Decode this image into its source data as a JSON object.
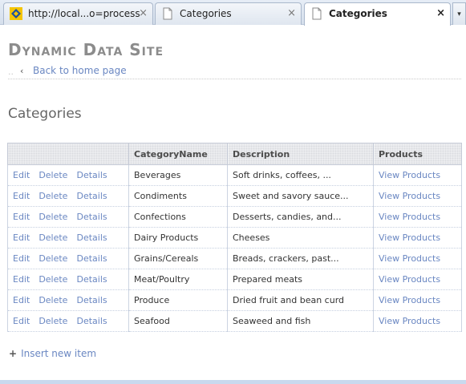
{
  "browser": {
    "tabs": [
      {
        "label": "http://local...o=processar",
        "close": "×",
        "icon": "site-favicon-icon",
        "active": false
      },
      {
        "label": "Categories",
        "close": "×",
        "icon": "page-icon",
        "active": false
      },
      {
        "label": "Categories",
        "close": "×",
        "icon": "page-icon",
        "active": true
      }
    ],
    "dropdown": "▾"
  },
  "page": {
    "site_title": "Dynamic Data Site",
    "home_link": "Back to home page",
    "heading": "Categories",
    "insert_link": "Insert new item"
  },
  "grid": {
    "columns": [
      "",
      "CategoryName",
      "Description",
      "Products"
    ],
    "action_labels": {
      "edit": "Edit",
      "delete": "Delete",
      "details": "Details"
    },
    "rows": [
      {
        "name": "Beverages",
        "description": "Soft drinks, coffees, ...",
        "products": "View Products"
      },
      {
        "name": "Condiments",
        "description": "Sweet and savory sauce...",
        "products": "View Products"
      },
      {
        "name": "Confections",
        "description": "Desserts, candies, and...",
        "products": "View Products"
      },
      {
        "name": "Dairy Products",
        "description": "Cheeses",
        "products": "View Products"
      },
      {
        "name": "Grains/Cereals",
        "description": "Breads, crackers, past...",
        "products": "View Products"
      },
      {
        "name": "Meat/Poultry",
        "description": "Prepared meats",
        "products": "View Products"
      },
      {
        "name": "Produce",
        "description": "Dried fruit and bean curd",
        "products": "View Products"
      },
      {
        "name": "Seafood",
        "description": "Seaweed and fish",
        "products": "View Products"
      }
    ]
  },
  "colors": {
    "link": "#6a87c2",
    "title": "#8c8c8c",
    "header_bg": "#d9dbe0"
  }
}
